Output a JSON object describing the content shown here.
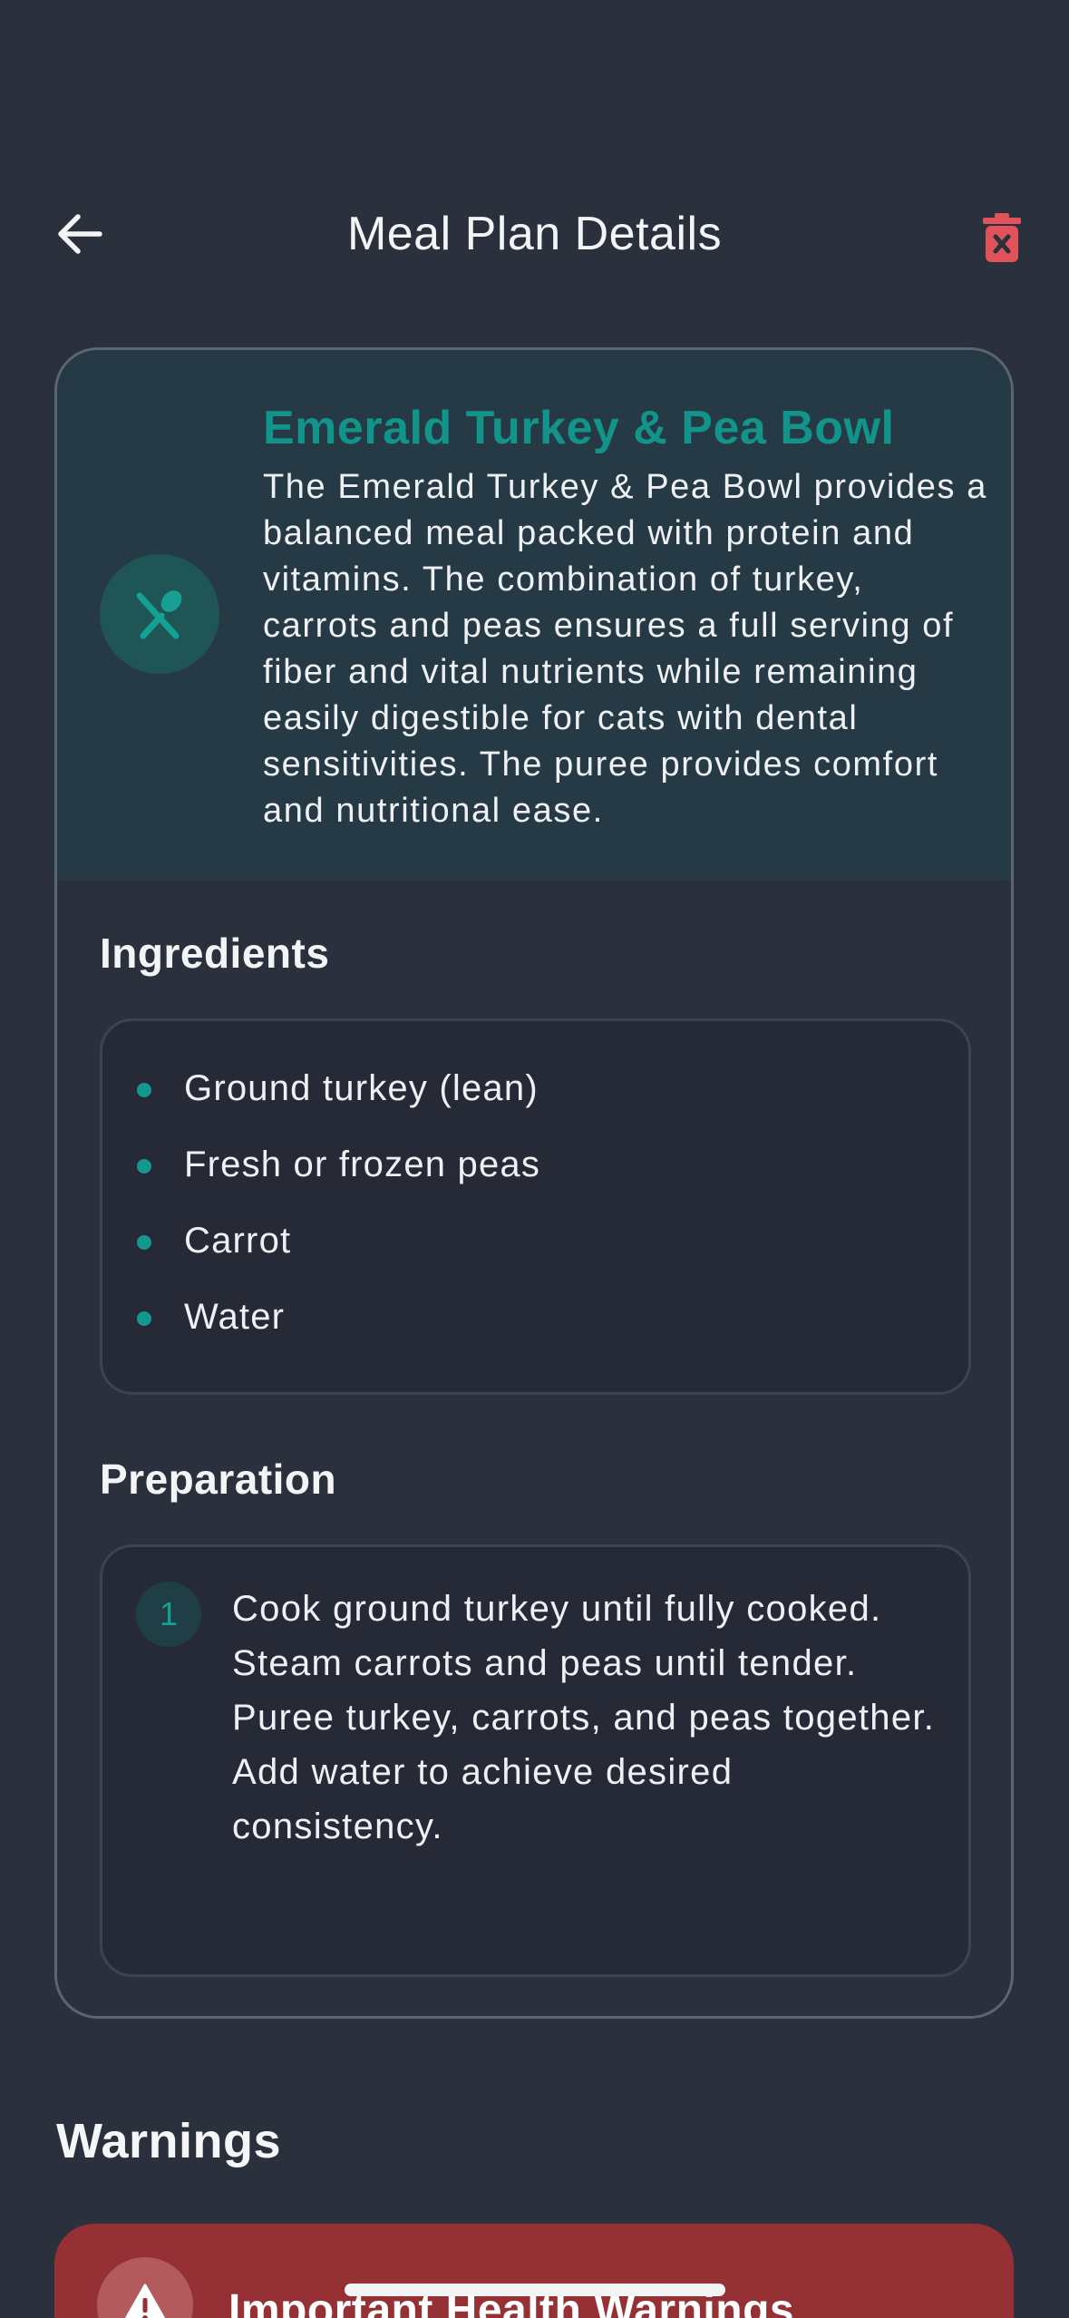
{
  "header": {
    "title": "Meal Plan Details",
    "back_icon": "arrow-left-icon",
    "delete_icon": "trash-icon"
  },
  "meal": {
    "icon": "utensils-icon",
    "name": "Emerald Turkey & Pea Bowl",
    "description": "The Emerald Turkey & Pea Bowl provides a balanced meal packed with protein and vitamins. The combination of turkey, carrots and peas ensures a full serving of fiber and vital nutrients while remaining easily digestible for cats with dental sensitivities. The puree provides comfort and nutritional ease."
  },
  "ingredients": {
    "title": "Ingredients",
    "items": [
      {
        "label": "Ground turkey (lean)"
      },
      {
        "label": "Fresh or frozen peas"
      },
      {
        "label": "Carrot"
      },
      {
        "label": "Water"
      }
    ]
  },
  "preparation": {
    "title": "Preparation",
    "steps": [
      {
        "number": "1",
        "text": "Cook ground turkey until fully cooked. Steam carrots and peas until tender.  Puree turkey, carrots, and peas together.  Add water to achieve desired consistency."
      }
    ]
  },
  "warnings": {
    "title": "Warnings",
    "card_title": "Important Health Warnings",
    "icon": "warning-triangle-icon"
  },
  "colors": {
    "background": "#2b303d",
    "accent": "#13948a",
    "danger": "#e2525a",
    "warning_card": "#953034"
  }
}
